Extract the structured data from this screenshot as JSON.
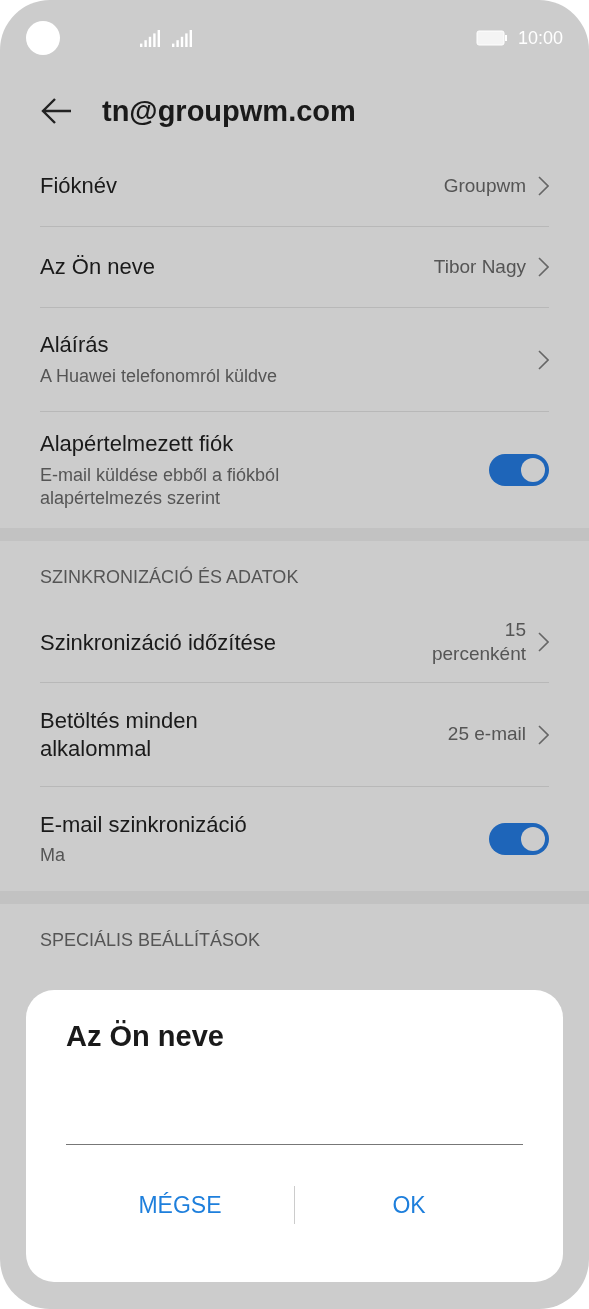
{
  "status_bar": {
    "time": "10:00"
  },
  "header": {
    "title": "tn@groupwm.com"
  },
  "sections": [
    {
      "items": [
        {
          "kind": "link",
          "label": "Fióknév",
          "value": "Groupwm"
        },
        {
          "kind": "link",
          "label": "Az Ön neve",
          "value": "Tibor Nagy"
        },
        {
          "kind": "link",
          "label": "Aláírás",
          "subtitle": "A Huawei telefonomról küldve"
        },
        {
          "kind": "toggle",
          "label": "Alapértelmezett fiók",
          "subtitle": "E-mail küldése ebből a fiókból alapértelmezés szerint",
          "on": true
        }
      ]
    },
    {
      "title": "SZINKRONIZÁCIÓ ÉS ADATOK",
      "items": [
        {
          "kind": "link",
          "label": "Szinkronizáció időzítése",
          "value": "15 percenként"
        },
        {
          "kind": "link",
          "label": "Betöltés minden alkalommal",
          "value": "25 e-mail"
        },
        {
          "kind": "toggle",
          "label": "E-mail szinkronizáció",
          "subtitle": "Ma",
          "on": true
        }
      ]
    },
    {
      "title": "SPECIÁLIS BEÁLLÍTÁSOK"
    }
  ],
  "dialog": {
    "title": "Az Ön neve",
    "buttons": [
      "MÉGSE",
      "OK"
    ]
  }
}
